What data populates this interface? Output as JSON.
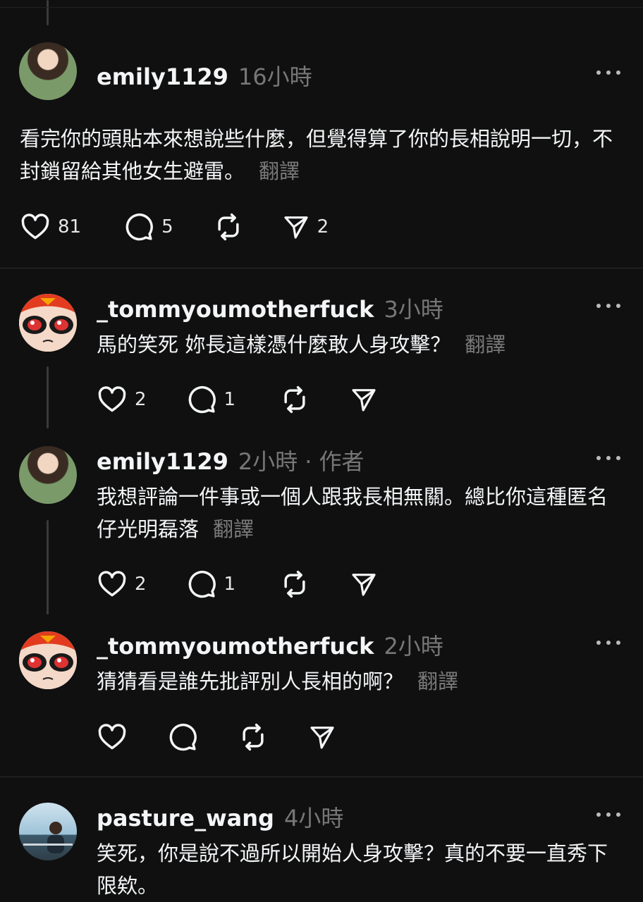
{
  "posts": [
    {
      "username": "emily1129",
      "time": "16小時",
      "text": "看完你的頭貼本來想說些什麼，但覺得算了你的長相說明一切，不封鎖留給其他女生避雷。",
      "translate": "翻譯",
      "likes": "81",
      "replies": "5",
      "reposts": "",
      "shares": "2"
    },
    {
      "username": "_tommyoumotherfuck",
      "time": "3小時",
      "text": "馬的笑死 妳長這樣憑什麼敢人身攻擊？",
      "translate": "翻譯",
      "likes": "2",
      "replies": "1"
    },
    {
      "username": "emily1129",
      "time": "2小時",
      "separator": "·",
      "author_badge": "作者",
      "text": "我想評論一件事或一個人跟我長相無關。總比你這種匿名仔光明磊落",
      "translate": "翻譯",
      "likes": "2",
      "replies": "1"
    },
    {
      "username": "_tommyoumotherfuck",
      "time": "2小時",
      "text": "猜猜看是誰先批評別人長相的啊？",
      "translate": "翻譯"
    },
    {
      "username": "pasture_wang",
      "time": "4小時",
      "text": "笑死，你是說不過所以開始人身攻擊？真的不要一直秀下限欸。"
    }
  ],
  "icons": {
    "like": "heart-icon",
    "reply": "comment-icon",
    "repost": "repost-icon",
    "share": "send-icon",
    "more": "more-options-icon"
  },
  "colors": {
    "background": "#101010",
    "text": "#f3f5f7",
    "muted": "#777777"
  }
}
